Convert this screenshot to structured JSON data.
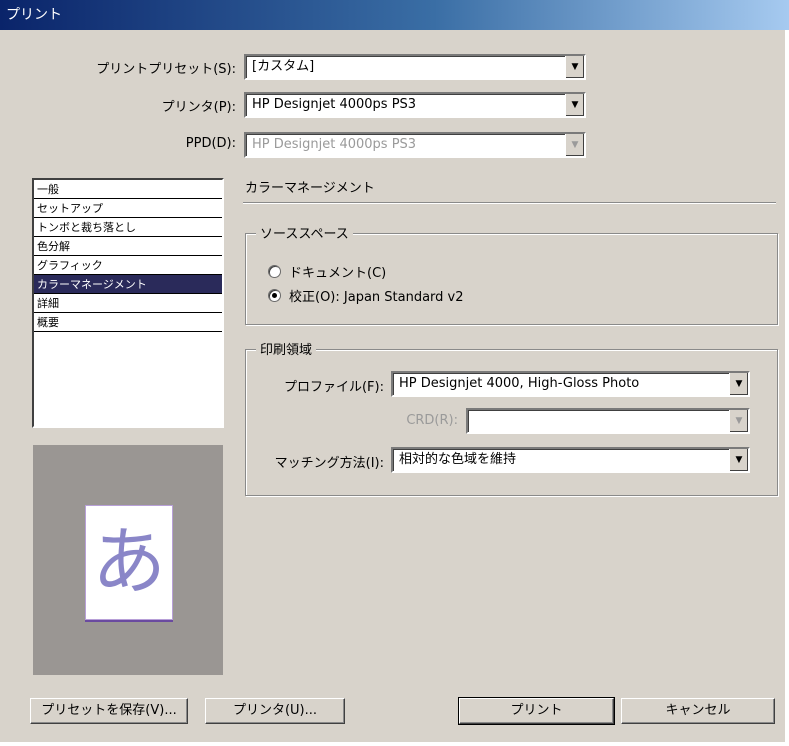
{
  "window": {
    "title": "プリント"
  },
  "preset": {
    "label": "プリントプリセット(S):",
    "value": "[カスタム]"
  },
  "printer": {
    "label": "プリンタ(P):",
    "value": "HP Designjet 4000ps PS3"
  },
  "ppd": {
    "label": "PPD(D):",
    "value": "HP Designjet 4000ps PS3"
  },
  "sidebar": {
    "items": [
      {
        "label": "一般",
        "selected": false
      },
      {
        "label": "セットアップ",
        "selected": false
      },
      {
        "label": "トンボと裁ち落とし",
        "selected": false
      },
      {
        "label": "色分解",
        "selected": false
      },
      {
        "label": "グラフィック",
        "selected": false
      },
      {
        "label": "カラーマネージメント",
        "selected": true
      },
      {
        "label": "詳細",
        "selected": false
      },
      {
        "label": "概要",
        "selected": false
      }
    ]
  },
  "preview": {
    "glyph": "あ"
  },
  "section": {
    "title": "カラーマネージメント"
  },
  "source_space": {
    "title": "ソーススペース",
    "options": [
      {
        "label": "ドキュメント(C)",
        "checked": false
      },
      {
        "label": "校正(O): Japan Standard v2",
        "checked": true
      }
    ]
  },
  "print_space": {
    "title": "印刷領域",
    "profile_label": "プロファイル(F):",
    "profile_value": "HP Designjet 4000, High-Gloss Photo",
    "crd_label": "CRD(R):",
    "crd_value": "",
    "intent_label": "マッチング方法(I):",
    "intent_value": "相対的な色域を維持"
  },
  "buttons": {
    "save_preset": "プリセットを保存(V)...",
    "printer": "プリンタ(U)...",
    "print": "プリント",
    "cancel": "キャンセル"
  },
  "colors": {
    "selection": "#2a2a5a",
    "dialog_bg": "#d8d3cb",
    "title_bar": "#0a246a"
  }
}
